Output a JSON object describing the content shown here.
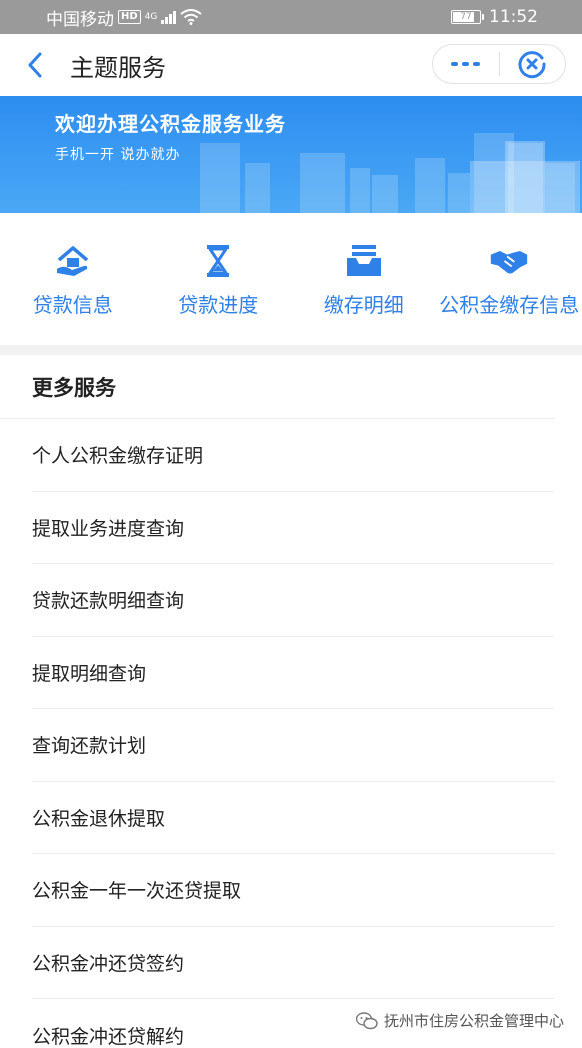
{
  "status_bar": {
    "carrier": "中国移动",
    "hd": "HD",
    "network": "4G",
    "battery": "77",
    "time": "11:52"
  },
  "nav": {
    "title": "主题服务"
  },
  "banner": {
    "title": "欢迎办理公积金服务业务",
    "subtitle": "手机一开 说办就办"
  },
  "quick_actions": [
    {
      "label": "贷款信息",
      "icon": "house-hand-icon"
    },
    {
      "label": "贷款进度",
      "icon": "hourglass-icon"
    },
    {
      "label": "缴存明细",
      "icon": "inbox-tray-icon"
    },
    {
      "label": "公积金缴存信息",
      "icon": "handshake-icon"
    }
  ],
  "more_services": {
    "title": "更多服务",
    "items": [
      "个人公积金缴存证明",
      "提取业务进度查询",
      "贷款还款明细查询",
      "提取明细查询",
      "查询还款计划",
      "公积金退休提取",
      "公积金一年一次还贷提取",
      "公积金冲还贷签约",
      "公积金冲还贷解约"
    ]
  },
  "watermark": "抚州市住房公积金管理中心",
  "colors": {
    "accent": "#2f80e7",
    "banner": "#2d8df0",
    "status_bar": "#9a9a9a"
  }
}
